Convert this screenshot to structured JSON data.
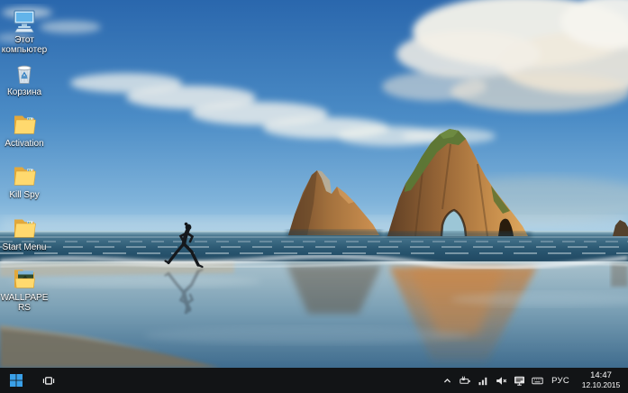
{
  "desktop": {
    "wallpaper_alt": "Beach with two arched rock formations, clouds, and a runner reflected on wet sand",
    "icons": [
      {
        "label": "Этот компьютер",
        "icon": "computer-icon"
      },
      {
        "label": "Корзина",
        "icon": "recycle-bin-icon"
      },
      {
        "label": "Activation",
        "icon": "folder-icon"
      },
      {
        "label": "Kill Spy",
        "icon": "folder-icon"
      },
      {
        "label": "Start Menu",
        "icon": "folder-icon"
      },
      {
        "label": "WALLPAPERS",
        "icon": "folder-images-icon"
      }
    ]
  },
  "taskbar": {
    "buttons": [
      {
        "name": "start-button",
        "icon": "windows-logo-icon"
      },
      {
        "name": "task-view-button",
        "icon": "task-view-icon"
      }
    ],
    "tray": {
      "icons": [
        "hidden-icons-chevron",
        "power-icon",
        "network-icon",
        "volume-muted-icon",
        "display-icon",
        "touch-keyboard-icon"
      ],
      "language_indicator": "РУС",
      "clock": {
        "time": "14:47",
        "date": "12.10.2015"
      }
    }
  },
  "colors": {
    "taskbar_background": "#121416",
    "start_logo_blue": "#3aa0e8",
    "tray_icon_white": "#eeeeee",
    "desktop_label_white": "#ffffff",
    "sky_top_blue": "#2a67ad",
    "cloud_white": "#f2f3ee",
    "sea_dark_blue": "#2b5872",
    "wet_sand_blue": "#7ba0b5",
    "rock_lit_orange": "#d09352",
    "rock_shadow_brown": "#5f3f24",
    "rock_moss_green": "#5b7836",
    "folder_yellow": "#ffd96e"
  }
}
